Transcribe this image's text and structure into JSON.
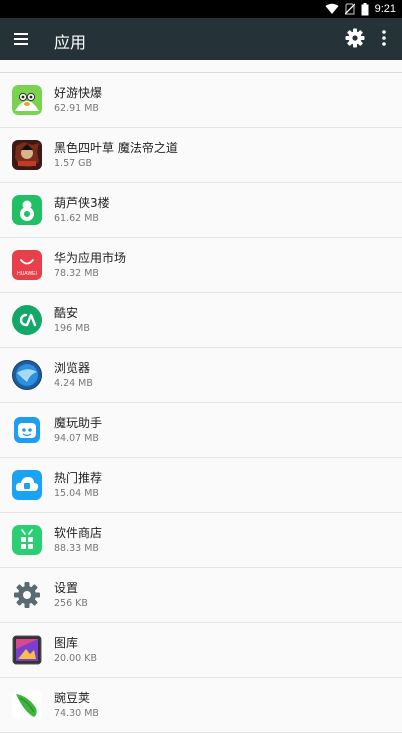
{
  "status_bar": {
    "time": "9:21"
  },
  "app_bar": {
    "title": "应用"
  },
  "apps": [
    {
      "name": "好游快爆",
      "size": "62.91 MB",
      "icon": "haoyou-kuaibao-icon"
    },
    {
      "name": "黑色四叶草 魔法帝之道",
      "size": "1.57 GB",
      "icon": "black-clover-icon"
    },
    {
      "name": "葫芦侠3楼",
      "size": "61.62 MB",
      "icon": "huluxia-icon"
    },
    {
      "name": "华为应用市场",
      "size": "78.32 MB",
      "icon": "huawei-appgallery-icon",
      "icon_text": "HUAWEI"
    },
    {
      "name": "酷安",
      "size": "196 MB",
      "icon": "coolapk-icon"
    },
    {
      "name": "浏览器",
      "size": "4.24 MB",
      "icon": "browser-icon"
    },
    {
      "name": "魔玩助手",
      "size": "94.07 MB",
      "icon": "mowan-icon"
    },
    {
      "name": "热门推荐",
      "size": "15.04 MB",
      "icon": "hot-recommend-icon"
    },
    {
      "name": "软件商店",
      "size": "88.33 MB",
      "icon": "software-store-icon"
    },
    {
      "name": "设置",
      "size": "256 KB",
      "icon": "settings-gear-icon"
    },
    {
      "name": "图库",
      "size": "20.00 KB",
      "icon": "gallery-icon"
    },
    {
      "name": "豌豆荚",
      "size": "74.30 MB",
      "icon": "wandoujia-icon"
    }
  ]
}
